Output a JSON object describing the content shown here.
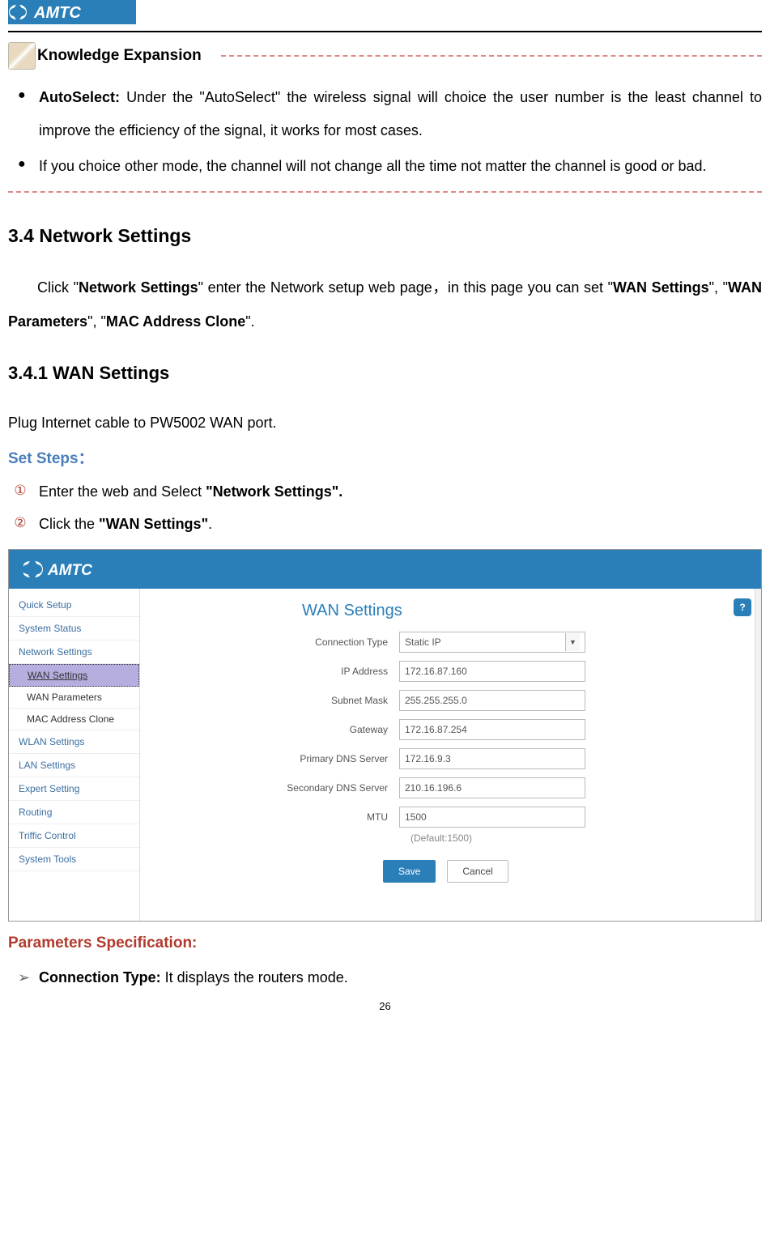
{
  "brand": "AMTC",
  "knowledge_expansion": {
    "title": "Knowledge Expansion",
    "items": [
      {
        "strong": "AutoSelect:",
        "text": " Under the \"AutoSelect\" the wireless signal will choice the user number is the least channel to improve the efficiency of the signal, it works for most cases."
      },
      {
        "strong": "",
        "text": "If you choice other mode, the channel will not change all the time not matter the channel is good or bad."
      }
    ]
  },
  "section34": {
    "heading": "3.4 Network Settings",
    "para_pre": "Click \"",
    "para_b1": "Network Settings",
    "para_mid1": "\" enter the Network setup web page，in this page you can set \"",
    "para_b2": "WAN Settings",
    "para_mid2": "\", \"",
    "para_b3": "WAN Parameters",
    "para_mid3": "\", \"",
    "para_b4": "MAC Address Clone",
    "para_post": "\"."
  },
  "section341": {
    "heading": "3.4.1 WAN Settings",
    "plug": "Plug Internet cable to PW5002 WAN port.",
    "set_steps_label": "Set Steps：",
    "steps": [
      {
        "num": "①",
        "pre": "Enter the web and Select ",
        "bold": "\"Network Settings\"."
      },
      {
        "num": "②",
        "pre": "Click the ",
        "bold": "\"WAN Settings\"",
        "post": "."
      }
    ]
  },
  "router_ui": {
    "sidebar": [
      {
        "label": "Quick Setup",
        "type": "item"
      },
      {
        "label": "System Status",
        "type": "item"
      },
      {
        "label": "Network Settings",
        "type": "item"
      },
      {
        "label": "WAN Settings",
        "type": "sub",
        "active": true
      },
      {
        "label": "WAN Parameters",
        "type": "sub"
      },
      {
        "label": "MAC Address Clone",
        "type": "sub"
      },
      {
        "label": "WLAN Settings",
        "type": "item"
      },
      {
        "label": "LAN Settings",
        "type": "item"
      },
      {
        "label": "Expert Setting",
        "type": "item"
      },
      {
        "label": "Routing",
        "type": "item"
      },
      {
        "label": "Triffic Control",
        "type": "item"
      },
      {
        "label": "System Tools",
        "type": "item"
      }
    ],
    "title": "WAN Settings",
    "help": "?",
    "fields": [
      {
        "label": "Connection Type",
        "value": "Static IP",
        "type": "select"
      },
      {
        "label": "IP Address",
        "value": "172.16.87.160",
        "type": "text"
      },
      {
        "label": "Subnet Mask",
        "value": "255.255.255.0",
        "type": "text"
      },
      {
        "label": "Gateway",
        "value": "172.16.87.254",
        "type": "text"
      },
      {
        "label": "Primary DNS Server",
        "value": "172.16.9.3",
        "type": "text"
      },
      {
        "label": "Secondary DNS Server",
        "value": "210.16.196.6",
        "type": "text"
      },
      {
        "label": "MTU",
        "value": "1500",
        "type": "text"
      }
    ],
    "hint": "(Default:1500)",
    "buttons": {
      "save": "Save",
      "cancel": "Cancel"
    }
  },
  "params_spec": {
    "title": "Parameters Specification:",
    "items": [
      {
        "bold": "Connection Type:",
        "text": " It displays the routers mode."
      }
    ]
  },
  "page_number": "26"
}
